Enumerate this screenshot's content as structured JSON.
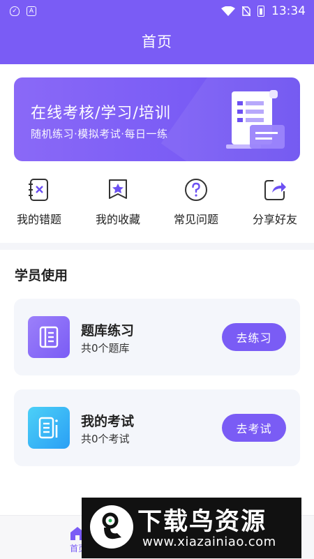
{
  "status_bar": {
    "time": "13:34",
    "left_icons": [
      "shield-icon",
      "a-box-icon"
    ],
    "right_icons": [
      "wifi-icon",
      "no-sim-icon",
      "battery-charging-icon"
    ]
  },
  "header": {
    "title": "首页"
  },
  "banner": {
    "title": "在线考核/学习/培训",
    "subtitle": "随机练习·模拟考试·每日一练",
    "icon": "document-icon"
  },
  "quick_actions": [
    {
      "label": "我的错题",
      "icon": "notebook-x-icon"
    },
    {
      "label": "我的收藏",
      "icon": "bookmark-star-icon"
    },
    {
      "label": "常见问题",
      "icon": "question-circle-icon"
    },
    {
      "label": "分享好友",
      "icon": "share-icon"
    }
  ],
  "section": {
    "title": "学员使用"
  },
  "cards": [
    {
      "title": "题库练习",
      "subtitle": "共0个题库",
      "button": "去练习",
      "icon": "book-icon",
      "icon_color": "#8b6cf6"
    },
    {
      "title": "我的考试",
      "subtitle": "共0个考试",
      "button": "去考试",
      "icon": "exam-icon",
      "icon_color": "#3ab4f5"
    }
  ],
  "bottom_nav": {
    "home_label": "首页"
  },
  "watermark": {
    "title": "下载鸟资源",
    "url": "www.xiazainiao.com"
  },
  "colors": {
    "primary": "#7a5cf5",
    "card_bg": "#f4f6fb"
  }
}
